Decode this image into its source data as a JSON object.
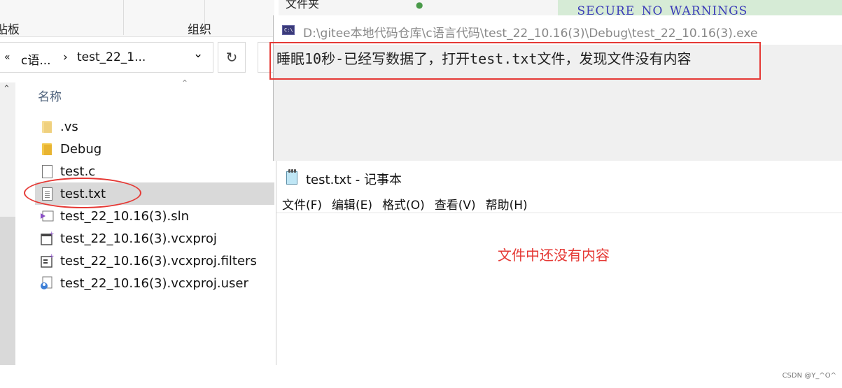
{
  "explorer": {
    "ribbon": {
      "left_fragment": "贴板",
      "group_label": "组织"
    },
    "address": {
      "back_chevrons": "«",
      "crumb1": "c语...",
      "sep": "›",
      "crumb2": "test_22_1...",
      "dropdown": "⌄",
      "refresh": "↻"
    },
    "column_header": "名称",
    "files": [
      {
        "name": ".vs",
        "type": "folder-pale"
      },
      {
        "name": "Debug",
        "type": "folder"
      },
      {
        "name": "test.c",
        "type": "c-file"
      },
      {
        "name": "test.txt",
        "type": "text-file",
        "selected": true
      },
      {
        "name": "test_22_10.16(3).sln",
        "type": "sln-file"
      },
      {
        "name": "test_22_10.16(3).vcxproj",
        "type": "vcxproj-file"
      },
      {
        "name": "test_22_10.16(3).vcxproj.filters",
        "type": "filters-file"
      },
      {
        "name": "test_22_10.16(3).vcxproj.user",
        "type": "user-file"
      }
    ]
  },
  "background": {
    "code_text": "_SECURE_NO_WARNINGS",
    "behind_window_text": "文件夹"
  },
  "console": {
    "icon_text": "C:\\",
    "title": "D:\\gitee本地代码仓库\\c语言代码\\test_22_10.16(3)\\Debug\\test_22_10.16(3).exe",
    "output": "睡眠10秒-已经写数据了，打开test.txt文件，发现文件没有内容"
  },
  "notepad": {
    "title": "test.txt - 记事本",
    "menu": [
      "文件(F)",
      "编辑(E)",
      "格式(O)",
      "查看(V)",
      "帮助(H)"
    ],
    "content": "",
    "annotation": "文件中还没有内容"
  },
  "watermark": "CSDN @Y_^O^",
  "colors": {
    "annotation_red": "#e53935",
    "selection_gray": "#d9d9d9"
  }
}
